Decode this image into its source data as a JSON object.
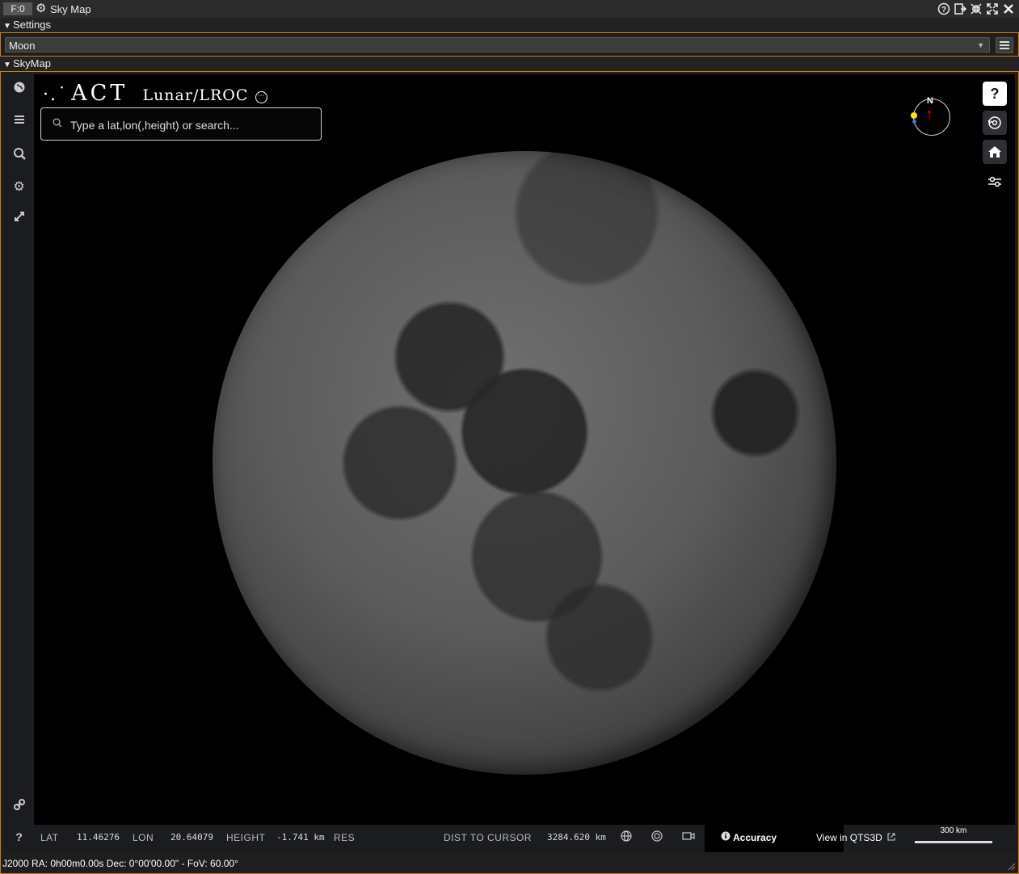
{
  "window": {
    "frame_label": "F:0",
    "title": "Sky Map",
    "controls": [
      "help-icon",
      "undock-icon",
      "shrink-icon",
      "maximize-icon",
      "close-icon"
    ]
  },
  "settings": {
    "section_label": "Settings",
    "target_value": "Moon"
  },
  "skymap": {
    "section_label": "SkyMap"
  },
  "viewer": {
    "logo_dots": "·.˙",
    "logo_text": "ACT",
    "map_name": "Lunar/LROC",
    "search_placeholder": "Type a lat,lon(,height) or search...",
    "compass_north": "N",
    "help_label": "?",
    "left_help": "?"
  },
  "bottom": {
    "lat_label": "LAT",
    "lat_value": "11.46276",
    "lon_label": "LON",
    "lon_value": "20.64079",
    "height_label": "HEIGHT",
    "height_value": "-1.741 km",
    "res_label": "RES",
    "dist_label": "DIST TO CURSOR",
    "dist_value": "3284.620 km",
    "accuracy_label": "Accuracy",
    "view_label": "View in QTS3D",
    "scale_label": "300 km"
  },
  "status": {
    "text": "J2000  RA: 0h00m0.00s  Dec: 0°00'00.00\" - FoV: 60.00°"
  }
}
